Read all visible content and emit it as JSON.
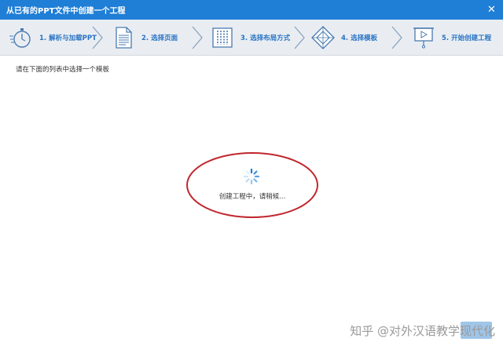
{
  "window": {
    "title": "从已有的PPT文件中创建一个工程",
    "close_glyph": "✕"
  },
  "steps": [
    {
      "label": "1. 解析与加载PPT",
      "icon": "stopwatch-icon"
    },
    {
      "label": "2. 选择页面",
      "icon": "document-icon"
    },
    {
      "label": "3. 选择布局方式",
      "icon": "layout-grid-icon"
    },
    {
      "label": "4. 选择模板",
      "icon": "diamond-template-icon"
    },
    {
      "label": "5. 开始创建工程",
      "icon": "presentation-board-icon"
    }
  ],
  "main": {
    "instruction": "请在下面的列表中选择一个模板",
    "loading_text": "创建工程中，请稍候...",
    "highlight_color": "#c0272d"
  },
  "watermark": "知乎 @对外汉语教学现代化",
  "colors": {
    "titlebar": "#1f7ed6",
    "accent": "#2a74c4"
  }
}
